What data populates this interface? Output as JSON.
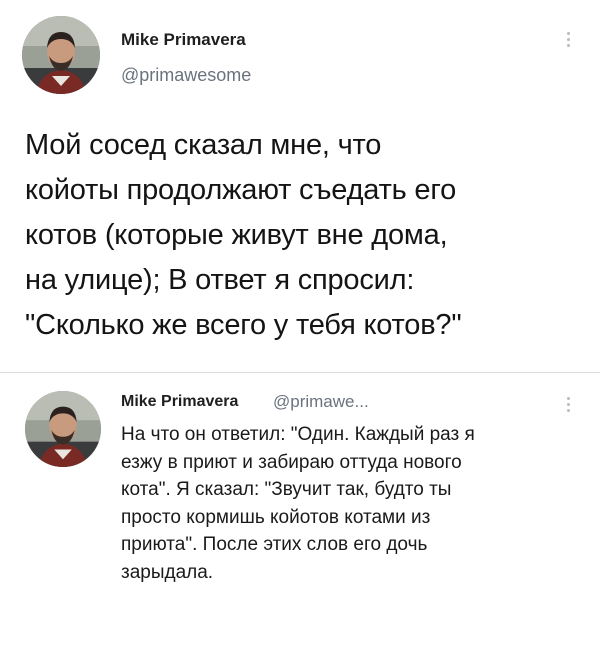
{
  "main_tweet": {
    "display_name": "Mike Primavera",
    "handle": "@primawesome",
    "text": "Мой сосед сказал мне, что\nкойоты продолжают съедать его\nкотов (которые живут вне дома,\nна улице); В ответ я спросил:\n\"Сколько же всего у тебя котов?\""
  },
  "reply_tweet": {
    "display_name": "Mike Primavera",
    "handle": "@primawe...",
    "text": "На что он ответил: \"Один. Каждый раз я\nезжу в приют и забираю оттуда нового\nкота\". Я сказал: \"Звучит так, будто ты\nпросто кормишь койотов котами из\nприюта\". После этих слов его дочь\nзарыдала."
  },
  "icons": {
    "avatar": "avatar-photo",
    "more": "more-vertical-icon"
  }
}
